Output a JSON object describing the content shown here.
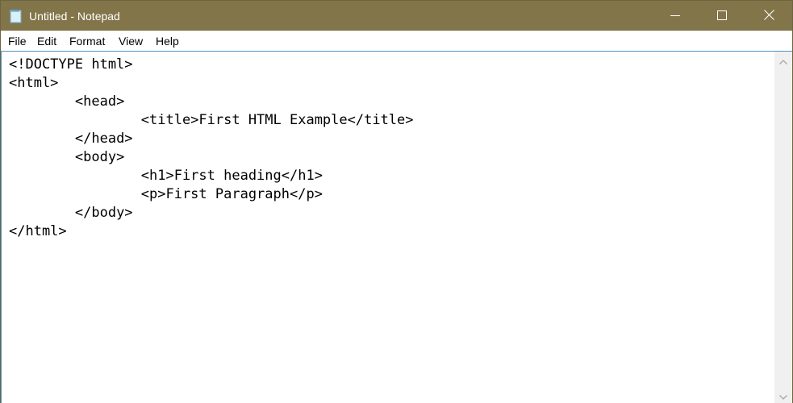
{
  "window": {
    "title": "Untitled - Notepad",
    "app_icon": "notepad-icon",
    "title_bar_color": "#82754a",
    "controls": {
      "minimize_icon": "minimize-icon",
      "maximize_icon": "maximize-icon",
      "close_icon": "close-icon"
    }
  },
  "menubar": {
    "items": [
      {
        "label": "File"
      },
      {
        "label": "Edit"
      },
      {
        "label": "Format"
      },
      {
        "label": "View"
      },
      {
        "label": "Help"
      }
    ]
  },
  "editor": {
    "content": "<!DOCTYPE html>\n<html>\n\t<head>\n\t\t<title>First HTML Example</title>\n\t</head>\n\t<body>\n\t\t<h1>First heading</h1>\n\t\t<p>First Paragraph</p>\n\t</body>\n</html>"
  },
  "scrollbar": {
    "up_icon": "chevron-up-icon",
    "down_icon": "chevron-down-icon"
  }
}
